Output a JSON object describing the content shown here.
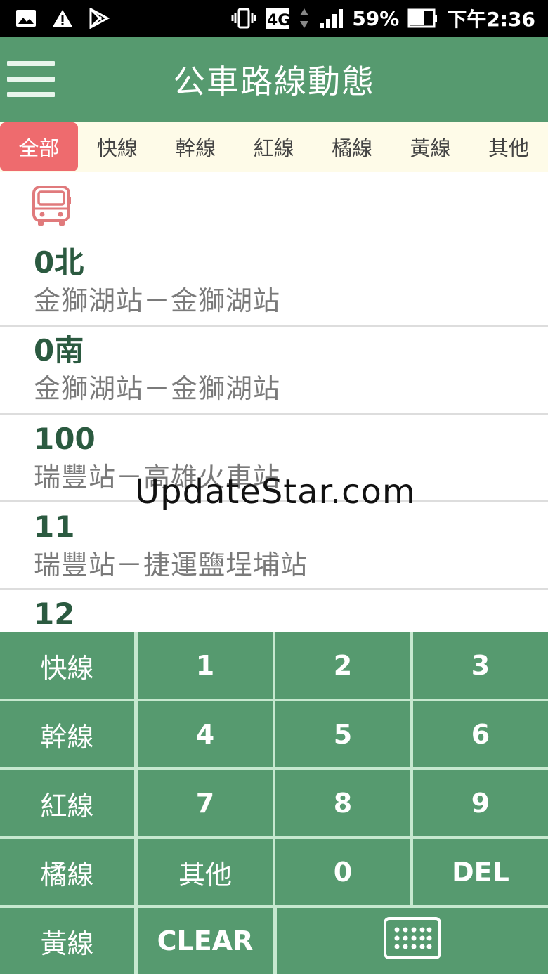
{
  "status_bar": {
    "signal_label": "4G",
    "battery": "59%",
    "time": "下午2:36"
  },
  "app_bar": {
    "title": "公車路線動態"
  },
  "tabs": [
    {
      "label": "全部",
      "active": true
    },
    {
      "label": "快線",
      "active": false
    },
    {
      "label": "幹線",
      "active": false
    },
    {
      "label": "紅線",
      "active": false
    },
    {
      "label": "橘線",
      "active": false
    },
    {
      "label": "黃線",
      "active": false
    },
    {
      "label": "其他",
      "active": false
    }
  ],
  "routes": [
    {
      "number": "0北",
      "desc": "金獅湖站－金獅湖站"
    },
    {
      "number": "0南",
      "desc": "金獅湖站－金獅湖站"
    },
    {
      "number": "100",
      "desc": "瑞豐站－高雄火車站"
    },
    {
      "number": "11",
      "desc": "瑞豐站－捷運鹽埕埔站"
    },
    {
      "number": "12",
      "desc": ""
    }
  ],
  "watermark": "UpdateStar.com",
  "keypad": {
    "row1": [
      "快線",
      "1",
      "2",
      "3"
    ],
    "row2": [
      "幹線",
      "4",
      "5",
      "6"
    ],
    "row3": [
      "紅線",
      "7",
      "8",
      "9"
    ],
    "row4": [
      "橘線",
      "其他",
      "0",
      "DEL"
    ],
    "row5": [
      "黃線",
      "CLEAR"
    ]
  },
  "colors": {
    "primary_green": "#569a6f",
    "active_tab": "#ee6b6e",
    "tab_bar_bg": "#fefbe8",
    "route_number": "#2b5a40"
  }
}
